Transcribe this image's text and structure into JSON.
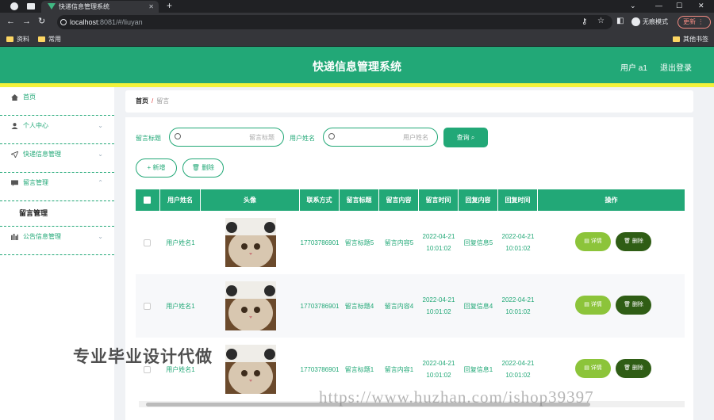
{
  "browser": {
    "tab_title": "快递信息管理系统",
    "url_host": "localhost",
    "url_path": ":8081/#/liuyan",
    "incognito_label": "无痕模式",
    "update_label": "更新",
    "bookmarks": [
      "资料",
      "常用"
    ],
    "other_bookmarks": "其他书签"
  },
  "header": {
    "title": "快递信息管理系统",
    "user": "用户 a1",
    "logout": "退出登录",
    "colors": {
      "primary": "#22a877",
      "accent_line": "#f2f23a"
    }
  },
  "sidebar": {
    "items": [
      {
        "label": "首页",
        "icon": "home-icon"
      },
      {
        "label": "个人中心",
        "icon": "user-icon"
      },
      {
        "label": "快递信息管理",
        "icon": "send-icon"
      },
      {
        "label": "留言管理",
        "icon": "message-icon"
      },
      {
        "label": "公告信息管理",
        "icon": "notice-icon"
      }
    ],
    "submenu_label": "留言管理"
  },
  "breadcrumb": {
    "home": "首页",
    "separator": "/",
    "current": "留言"
  },
  "search": {
    "title_label": "留言标题",
    "title_placeholder": "留言标题",
    "user_label": "用户姓名",
    "user_placeholder": "用户姓名",
    "query_label": "查询"
  },
  "actions": {
    "add": "+ 新增",
    "delete": "删除"
  },
  "table": {
    "headers": [
      "用户姓名",
      "头像",
      "联系方式",
      "留言标题",
      "留言内容",
      "留言时间",
      "回复内容",
      "回复时间",
      "操作"
    ],
    "rows": [
      {
        "user": "用户姓名1",
        "phone": "17703786901",
        "title": "留言标题5",
        "content": "留言内容5",
        "time": "2022-04-21 10:01:02",
        "reply": "回复信息5",
        "reply_time": "2022-04-21 10:01:02"
      },
      {
        "user": "用户姓名1",
        "phone": "17703786901",
        "title": "留言标题4",
        "content": "留言内容4",
        "time": "2022-04-21 10:01:02",
        "reply": "回复信息4",
        "reply_time": "2022-04-21 10:01:02"
      },
      {
        "user": "用户姓名1",
        "phone": "17703786901",
        "title": "留言标题1",
        "content": "留言内容1",
        "time": "2022-04-21 10:01:02",
        "reply": "回复信息1",
        "reply_time": "2022-04-21 10:01:02"
      }
    ],
    "detail_label": "详情",
    "delete_label": "删除"
  },
  "watermarks": {
    "text1": "专业毕业设计代做",
    "text2": "https://www.huzhan.com/ishop39397"
  }
}
